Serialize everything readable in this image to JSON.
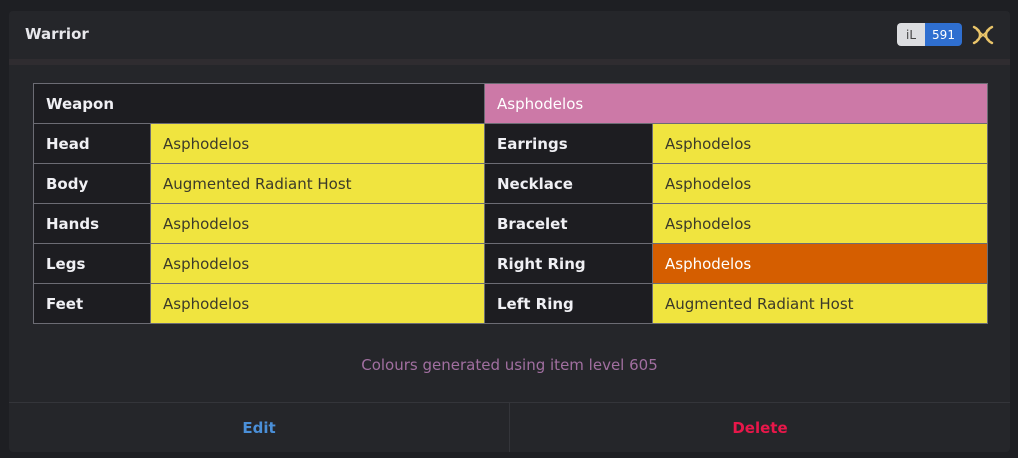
{
  "card": {
    "title": "Warrior",
    "item_level": {
      "label": "iL",
      "value": "591"
    },
    "job_icon": "warrior-job-icon"
  },
  "gear": {
    "weapon": {
      "slot": "Weapon",
      "item": "Asphodelos",
      "color": "#cc79a7"
    },
    "rows": [
      {
        "left_slot": "Head",
        "left_item": "Asphodelos",
        "left_color": "#f0e43f",
        "right_slot": "Earrings",
        "right_item": "Asphodelos",
        "right_color": "#f0e43f"
      },
      {
        "left_slot": "Body",
        "left_item": "Augmented Radiant Host",
        "left_color": "#f0e43f",
        "right_slot": "Necklace",
        "right_item": "Asphodelos",
        "right_color": "#f0e43f"
      },
      {
        "left_slot": "Hands",
        "left_item": "Asphodelos",
        "left_color": "#f0e43f",
        "right_slot": "Bracelet",
        "right_item": "Asphodelos",
        "right_color": "#f0e43f"
      },
      {
        "left_slot": "Legs",
        "left_item": "Asphodelos",
        "left_color": "#f0e43f",
        "right_slot": "Right Ring",
        "right_item": "Asphodelos",
        "right_color": "#d55e00"
      },
      {
        "left_slot": "Feet",
        "left_item": "Asphodelos",
        "left_color": "#f0e43f",
        "right_slot": "Left Ring",
        "right_item": "Augmented Radiant Host",
        "right_color": "#f0e43f"
      }
    ]
  },
  "note": "Colours generated using item level 605",
  "actions": {
    "edit_label": "Edit",
    "delete_label": "Delete"
  },
  "colors": {
    "accent_edit": "#4a8fd8",
    "accent_delete": "#e8174a",
    "note_color": "#a16fa0"
  }
}
